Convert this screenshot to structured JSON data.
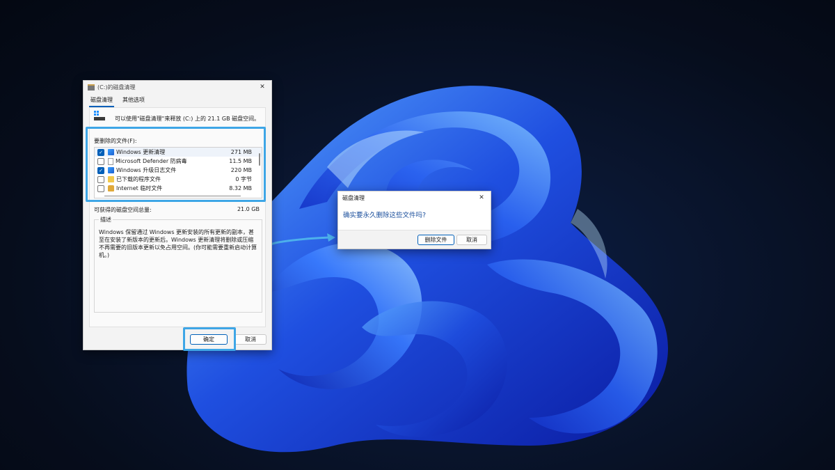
{
  "main_dialog": {
    "title": "(C:)的磁盘清理",
    "tabs": [
      {
        "label": "磁盘清理"
      },
      {
        "label": "其他选项"
      }
    ],
    "intro": "可以使用\"磁盘清理\"来释放 (C:) 上的 21.1 GB 磁盘空间。",
    "files_label": "要删除的文件(F):",
    "items": [
      {
        "name": "Windows 更新清理",
        "size": "271 MB",
        "checked": true,
        "icon": "windows-update-icon"
      },
      {
        "name": "Microsoft Defender 防病毒",
        "size": "11.5 MB",
        "checked": false,
        "icon": "file-icon"
      },
      {
        "name": "Windows 升级日志文件",
        "size": "220 MB",
        "checked": true,
        "icon": "windows-log-icon"
      },
      {
        "name": "已下载的程序文件",
        "size": "0 字节",
        "checked": false,
        "icon": "folder-icon"
      },
      {
        "name": "Internet 临时文件",
        "size": "8.32 MB",
        "checked": false,
        "icon": "lock-icon"
      }
    ],
    "total_label": "可获得的磁盘空间总量:",
    "total_value": "21.0 GB",
    "description_label": "描述",
    "description_text": "Windows 保留通过 Windows 更新安装的所有更新的副本，甚至在安装了新版本的更新后。Windows 更新清理将删除或压缩不再需要的旧版本更新以免占用空间。(你可能需要重新启动计算机。)",
    "ok_label": "确定",
    "cancel_label": "取消"
  },
  "confirm_dialog": {
    "title": "磁盘清理",
    "message": "确实要永久删除这些文件吗?",
    "delete_label": "删除文件",
    "cancel_label": "取消"
  },
  "colors": {
    "highlight": "#3ea6e6",
    "accent": "#005fb8"
  }
}
